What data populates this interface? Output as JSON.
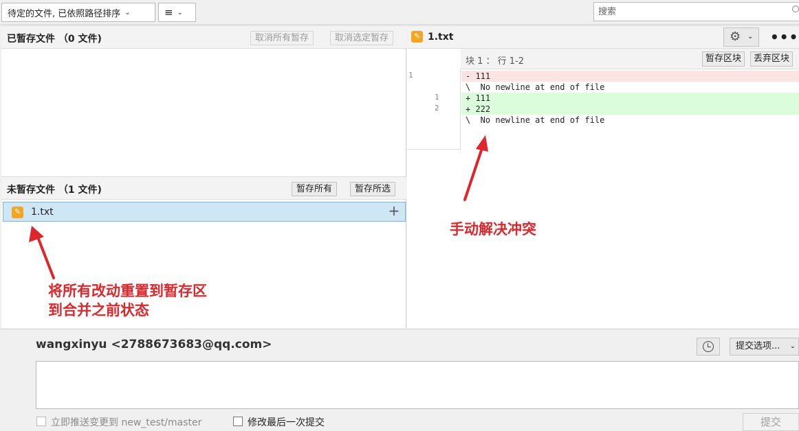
{
  "toolbar": {
    "sort_label": "待定的文件, 已依照路径排序",
    "view_icon": "list-icon",
    "search_placeholder": "搜索"
  },
  "staged": {
    "title": "已暂存文件 （0 文件)",
    "unstage_all": "取消所有暂存",
    "unstage_selected": "取消选定暂存"
  },
  "unstaged": {
    "title": "未暂存文件 （1 文件)",
    "stage_all": "暂存所有",
    "stage_selected": "暂存所选",
    "files": [
      {
        "name": "1.txt",
        "status_icon": "pencil-modified-icon"
      }
    ]
  },
  "diff": {
    "file_title": "1.txt",
    "hunk_label": "块 1 ： 行 1-2",
    "stage_hunk": "暂存区块",
    "discard_hunk": "丢弃区块",
    "old_line_numbers": [
      "1"
    ],
    "new_line_numbers": [
      "1",
      "2"
    ],
    "lines": [
      {
        "type": "del",
        "text": "- 111"
      },
      {
        "type": "ctx",
        "text": "\\  No newline at end of file"
      },
      {
        "type": "add",
        "text": "+ 111"
      },
      {
        "type": "add",
        "text": "+ 222"
      },
      {
        "type": "ctx",
        "text": "\\  No newline at end of file"
      }
    ],
    "colors": {
      "del": "#fde4e4",
      "add": "#dcfddc"
    }
  },
  "annotations": {
    "left_line1": "将所有改动重置到暂存区",
    "left_line2": "到合并之前状态",
    "right": "手动解决冲突",
    "color": "#e0262b"
  },
  "commit": {
    "author": "wangxinyu <2788673683@qq.com>",
    "options_label": "提交选项...",
    "push_label": "立即推送变更到 new_test/master",
    "amend_label": "修改最后一次提交",
    "submit_label": "提交"
  }
}
